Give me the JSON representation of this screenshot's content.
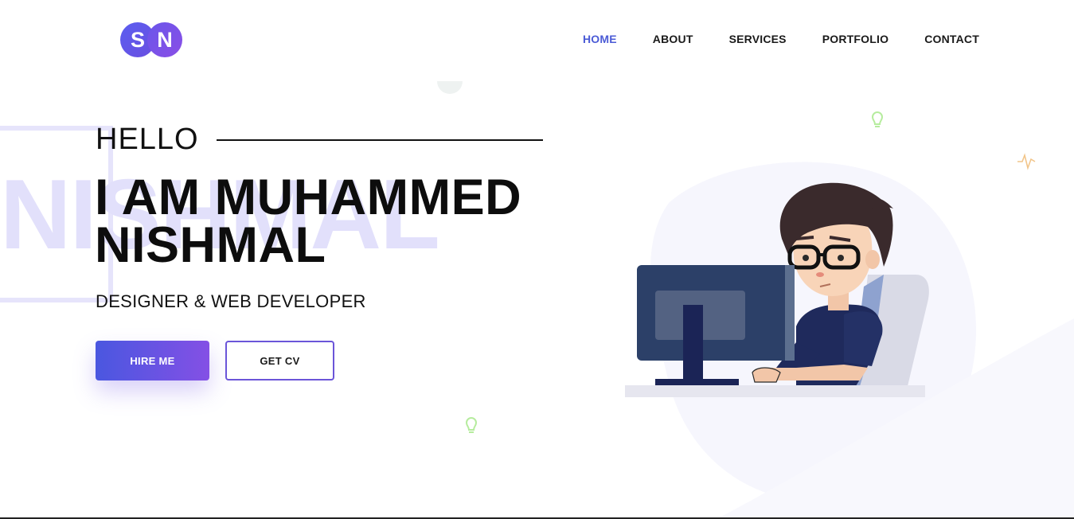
{
  "logo": {
    "letters": [
      "S",
      "N"
    ]
  },
  "nav": {
    "items": [
      {
        "label": "HOME",
        "active": true
      },
      {
        "label": "ABOUT",
        "active": false
      },
      {
        "label": "SERVICES",
        "active": false
      },
      {
        "label": "PORTFOLIO",
        "active": false
      },
      {
        "label": "CONTACT",
        "active": false
      }
    ]
  },
  "hero": {
    "greeting": "HELLO",
    "headline_line1": "I AM MUHAMMED",
    "headline_line2": "NISHMAL",
    "watermark": "NISHMAL",
    "subtitle": "DESIGNER & WEB DEVELOPER",
    "primary_button": "HIRE ME",
    "secondary_button": "GET CV"
  },
  "colors": {
    "accent": "#4b5bd6",
    "gradient_start": "#4a57e0",
    "gradient_end": "#8450e5",
    "watermark": "#e2e0fb"
  },
  "icons": [
    "lightbulb-icon",
    "heartbeat-icon",
    "developer-illustration"
  ]
}
